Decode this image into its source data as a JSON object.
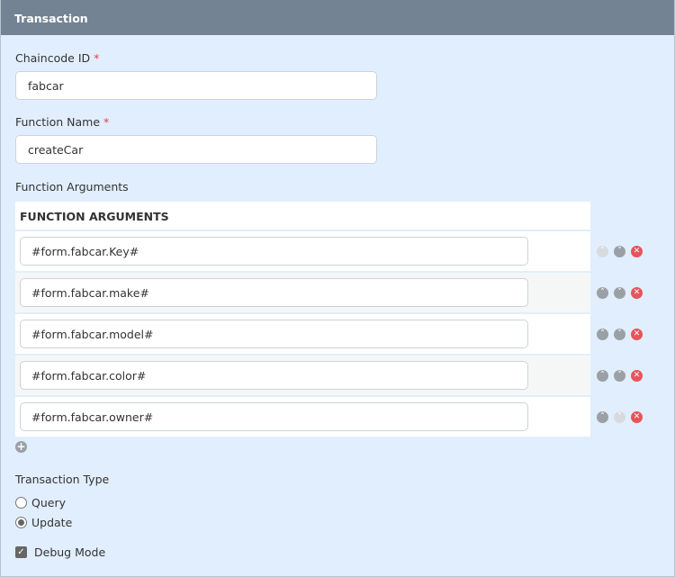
{
  "header": {
    "title": "Transaction"
  },
  "chaincode": {
    "label": "Chaincode ID",
    "required": "*",
    "value": "fabcar"
  },
  "function_name": {
    "label": "Function Name",
    "required": "*",
    "value": "createCar"
  },
  "args": {
    "label": "Function Arguments",
    "table_header": "FUNCTION ARGUMENTS",
    "rows": [
      {
        "value": "#form.fabcar.Key#"
      },
      {
        "value": "#form.fabcar.make#"
      },
      {
        "value": "#form.fabcar.model#"
      },
      {
        "value": "#form.fabcar.color#"
      },
      {
        "value": "#form.fabcar.owner#"
      }
    ]
  },
  "tx_type": {
    "label": "Transaction Type",
    "options": [
      "Query",
      "Update"
    ],
    "selected": "Update"
  },
  "debug": {
    "label": "Debug Mode",
    "checked": true
  }
}
